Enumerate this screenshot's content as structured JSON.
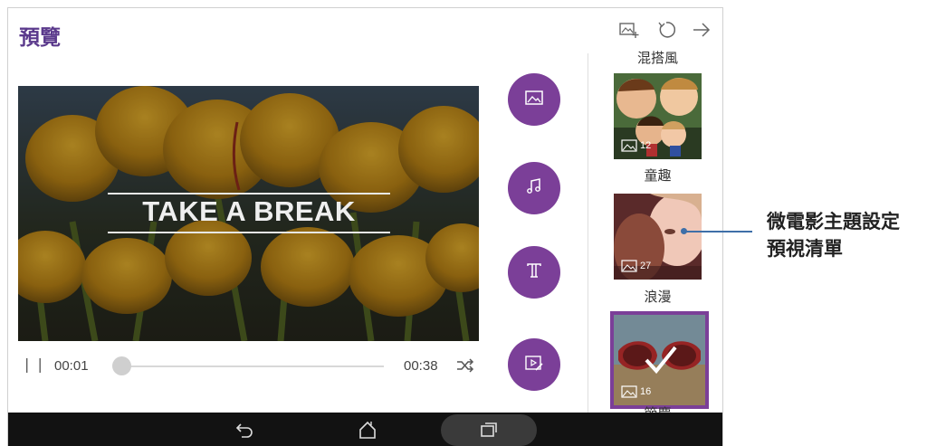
{
  "header": {
    "title": "預覽",
    "icons": [
      "add-photo-icon",
      "refresh-icon",
      "next-arrow-icon"
    ]
  },
  "video": {
    "title_text": "TAKE A BREAK"
  },
  "playback": {
    "pause_symbol": "| |",
    "current_time": "00:01",
    "total_time": "00:38",
    "progress": 0.03
  },
  "actions": [
    "image-icon",
    "music-note-icon",
    "text-icon",
    "video-edit-icon"
  ],
  "themes": {
    "top_label": "混搭風",
    "items": [
      {
        "label": "童趣",
        "count": "12"
      },
      {
        "label": "浪漫",
        "count": "27"
      },
      {
        "label": "節慶",
        "count": "16",
        "selected": true
      }
    ]
  },
  "nav": [
    "back-icon",
    "home-icon",
    "recent-apps-icon"
  ],
  "callout": {
    "line1": "微電影主題設定",
    "line2": "預視清單"
  },
  "colors": {
    "accent": "#7b3f98",
    "callout_line": "#3e6fa8"
  }
}
